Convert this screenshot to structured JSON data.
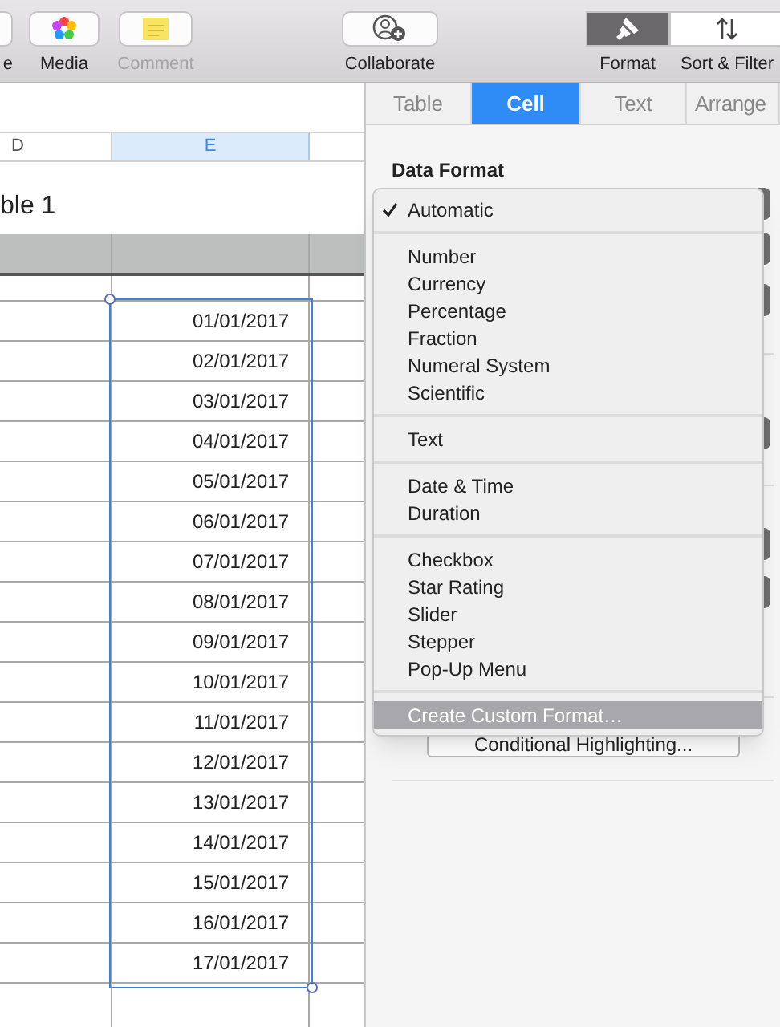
{
  "toolbar": {
    "buttons": [
      {
        "label": "e",
        "kind": "partial",
        "disabled": false
      },
      {
        "label": "Media",
        "kind": "media",
        "disabled": false
      },
      {
        "label": "Comment",
        "kind": "comment",
        "disabled": true
      },
      {
        "label": "Collaborate",
        "kind": "collaborate",
        "disabled": false
      }
    ],
    "view_buttons": [
      {
        "label": "Format",
        "kind": "format",
        "selected": true
      },
      {
        "label": "Sort & Filter",
        "kind": "sort",
        "selected": false
      }
    ]
  },
  "sheet": {
    "columns": [
      {
        "label": "D",
        "selected": false
      },
      {
        "label": "E",
        "selected": true
      }
    ],
    "table_title": "ble 1",
    "rows": [
      "01/01/2017",
      "02/01/2017",
      "03/01/2017",
      "04/01/2017",
      "05/01/2017",
      "06/01/2017",
      "07/01/2017",
      "08/01/2017",
      "09/01/2017",
      "10/01/2017",
      "11/01/2017",
      "12/01/2017",
      "13/01/2017",
      "14/01/2017",
      "15/01/2017",
      "16/01/2017",
      "17/01/2017"
    ]
  },
  "sidebar": {
    "tabs": [
      {
        "label": "Table",
        "selected": false
      },
      {
        "label": "Cell",
        "selected": true
      },
      {
        "label": "Text",
        "selected": false
      },
      {
        "label": "Arrange",
        "selected": false
      }
    ],
    "section_title": "Data Format",
    "background_button": "Conditional Highlighting...",
    "menu": [
      {
        "kind": "item",
        "label": "Automatic",
        "checked": true,
        "highlighted": false
      },
      {
        "kind": "separator"
      },
      {
        "kind": "item",
        "label": "Number",
        "checked": false,
        "highlighted": false
      },
      {
        "kind": "item",
        "label": "Currency",
        "checked": false,
        "highlighted": false
      },
      {
        "kind": "item",
        "label": "Percentage",
        "checked": false,
        "highlighted": false
      },
      {
        "kind": "item",
        "label": "Fraction",
        "checked": false,
        "highlighted": false
      },
      {
        "kind": "item",
        "label": "Numeral System",
        "checked": false,
        "highlighted": false
      },
      {
        "kind": "item",
        "label": "Scientific",
        "checked": false,
        "highlighted": false
      },
      {
        "kind": "separator"
      },
      {
        "kind": "item",
        "label": "Text",
        "checked": false,
        "highlighted": false
      },
      {
        "kind": "separator"
      },
      {
        "kind": "item",
        "label": "Date & Time",
        "checked": false,
        "highlighted": false
      },
      {
        "kind": "item",
        "label": "Duration",
        "checked": false,
        "highlighted": false
      },
      {
        "kind": "separator"
      },
      {
        "kind": "item",
        "label": "Checkbox",
        "checked": false,
        "highlighted": false
      },
      {
        "kind": "item",
        "label": "Star Rating",
        "checked": false,
        "highlighted": false
      },
      {
        "kind": "item",
        "label": "Slider",
        "checked": false,
        "highlighted": false
      },
      {
        "kind": "item",
        "label": "Stepper",
        "checked": false,
        "highlighted": false
      },
      {
        "kind": "item",
        "label": "Pop-Up Menu",
        "checked": false,
        "highlighted": false
      },
      {
        "kind": "separator"
      },
      {
        "kind": "item",
        "label": "Create Custom Format…",
        "checked": false,
        "highlighted": true
      }
    ]
  }
}
